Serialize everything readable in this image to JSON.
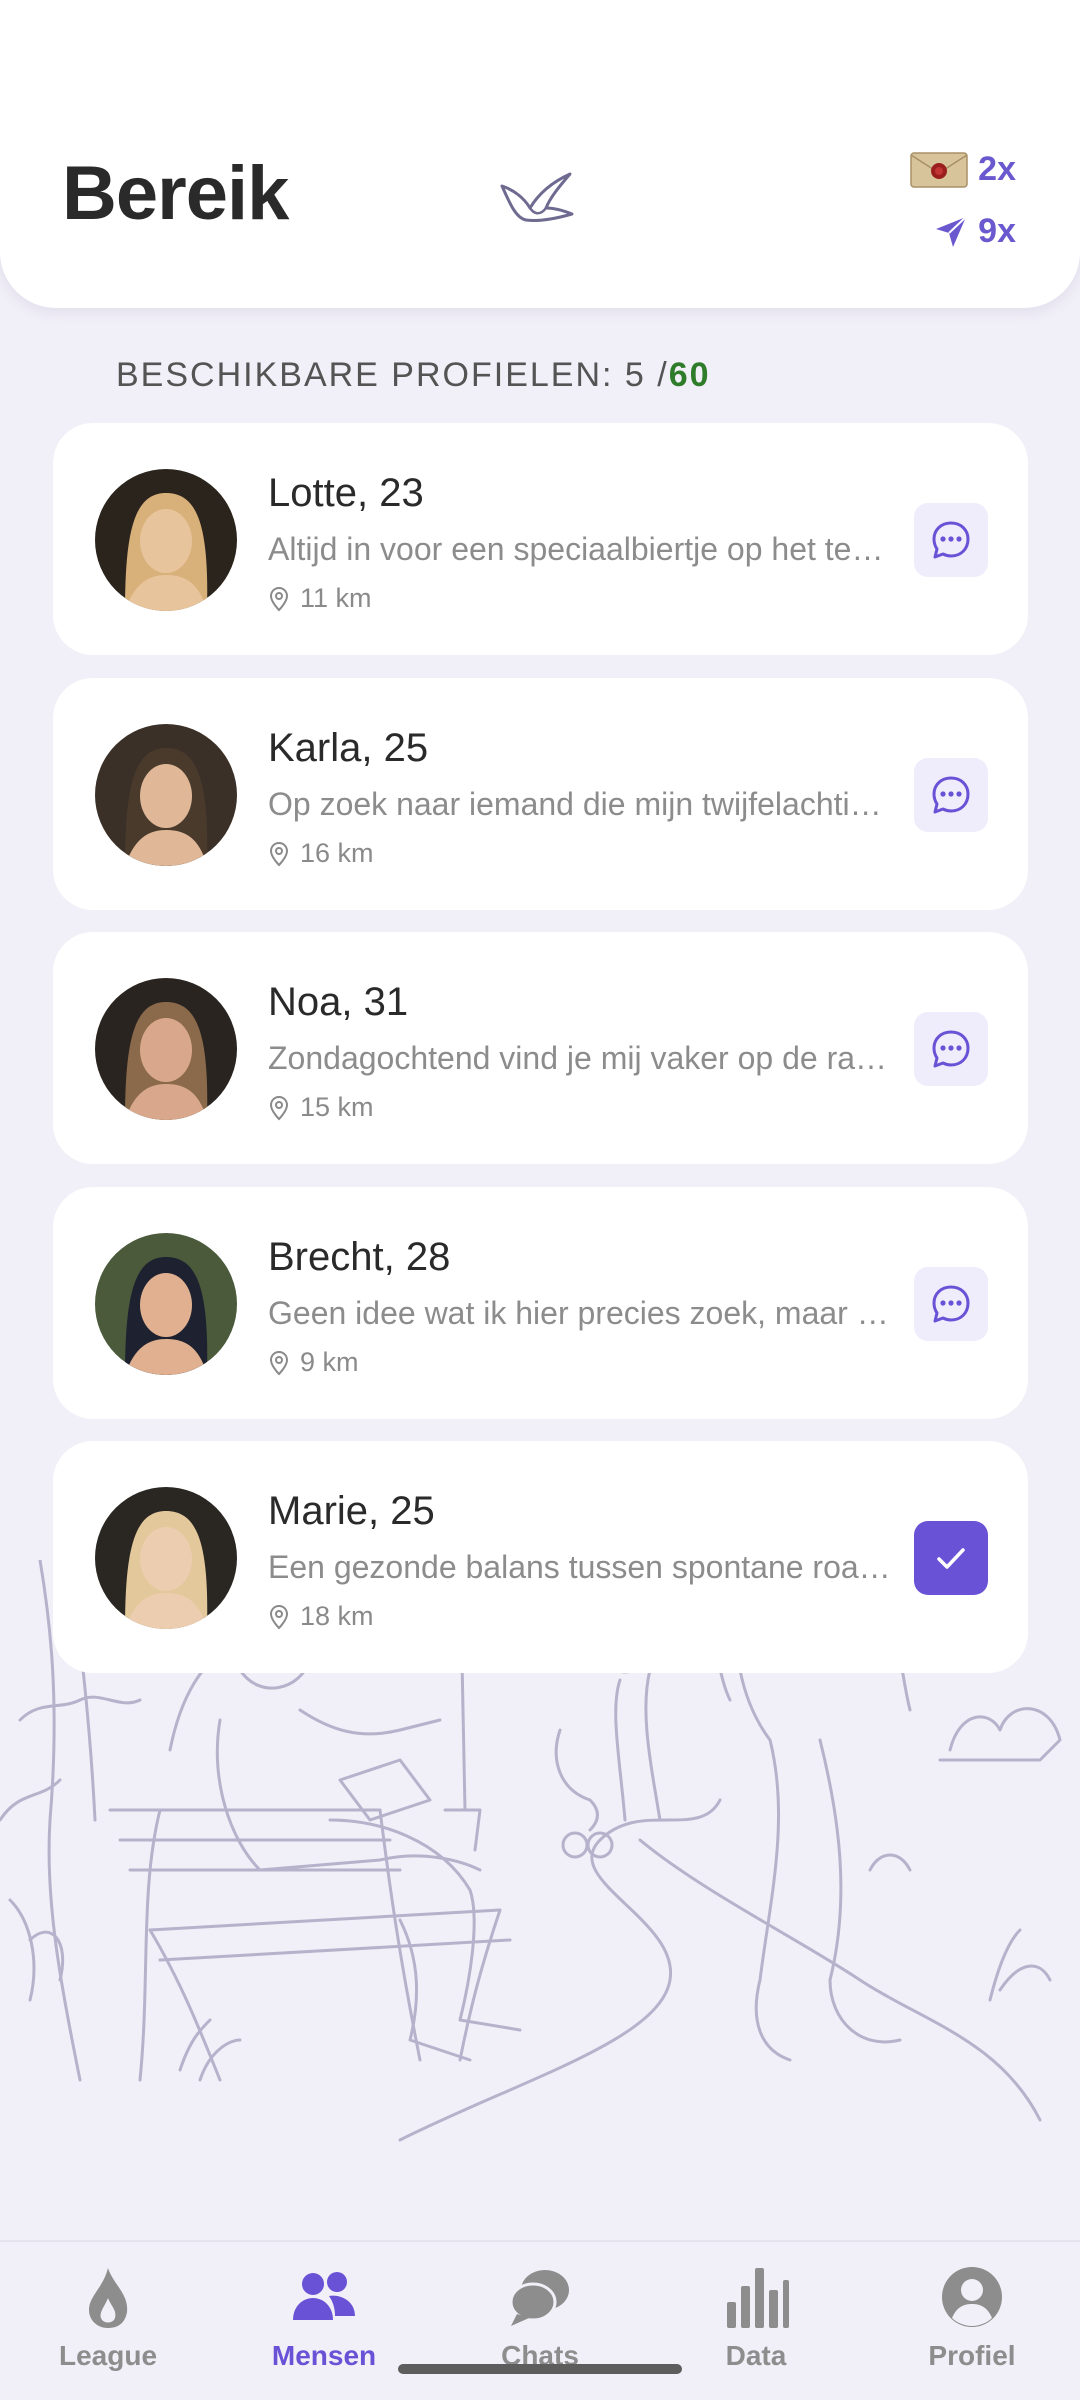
{
  "header": {
    "title": "Bereik",
    "letters_count": "2x",
    "sends_count": "9x"
  },
  "section": {
    "label": "BESCHIKBARE PROFIELEN: 5 / ",
    "max": "60"
  },
  "profiles": [
    {
      "name": "Lotte, 23",
      "bio": "Altijd in voor een speciaalbiertje op het terras",
      "distance": "11 km",
      "action": "chat"
    },
    {
      "name": "Karla, 25",
      "bio": "Op zoek naar iemand die mijn twijfelachtige humor snapt",
      "distance": "16 km",
      "action": "chat"
    },
    {
      "name": "Noa, 31",
      "bio": "Zondagochtend vind je mij vaker op de racefiets",
      "distance": "15 km",
      "action": "chat"
    },
    {
      "name": "Brecht, 28",
      "bio": "Geen idee wat ik hier precies zoek, maar een goed gesprek",
      "distance": "9 km",
      "action": "chat"
    },
    {
      "name": "Marie, 25",
      "bio": "Een gezonde balans tussen spontane roadtrips en thuis",
      "distance": "18 km",
      "action": "selected"
    }
  ],
  "nav": {
    "items": [
      {
        "label": "League",
        "icon": "flame-icon",
        "active": false
      },
      {
        "label": "Mensen",
        "icon": "people-icon",
        "active": true
      },
      {
        "label": "Chats",
        "icon": "chat-bubbles-icon",
        "active": false
      },
      {
        "label": "Data",
        "icon": "bar-chart-icon",
        "active": false
      },
      {
        "label": "Profiel",
        "icon": "user-circle-icon",
        "active": false
      }
    ]
  },
  "colors": {
    "accent": "#6a52d6",
    "background": "#f1eff7",
    "max_count": "#2f7c2a"
  }
}
